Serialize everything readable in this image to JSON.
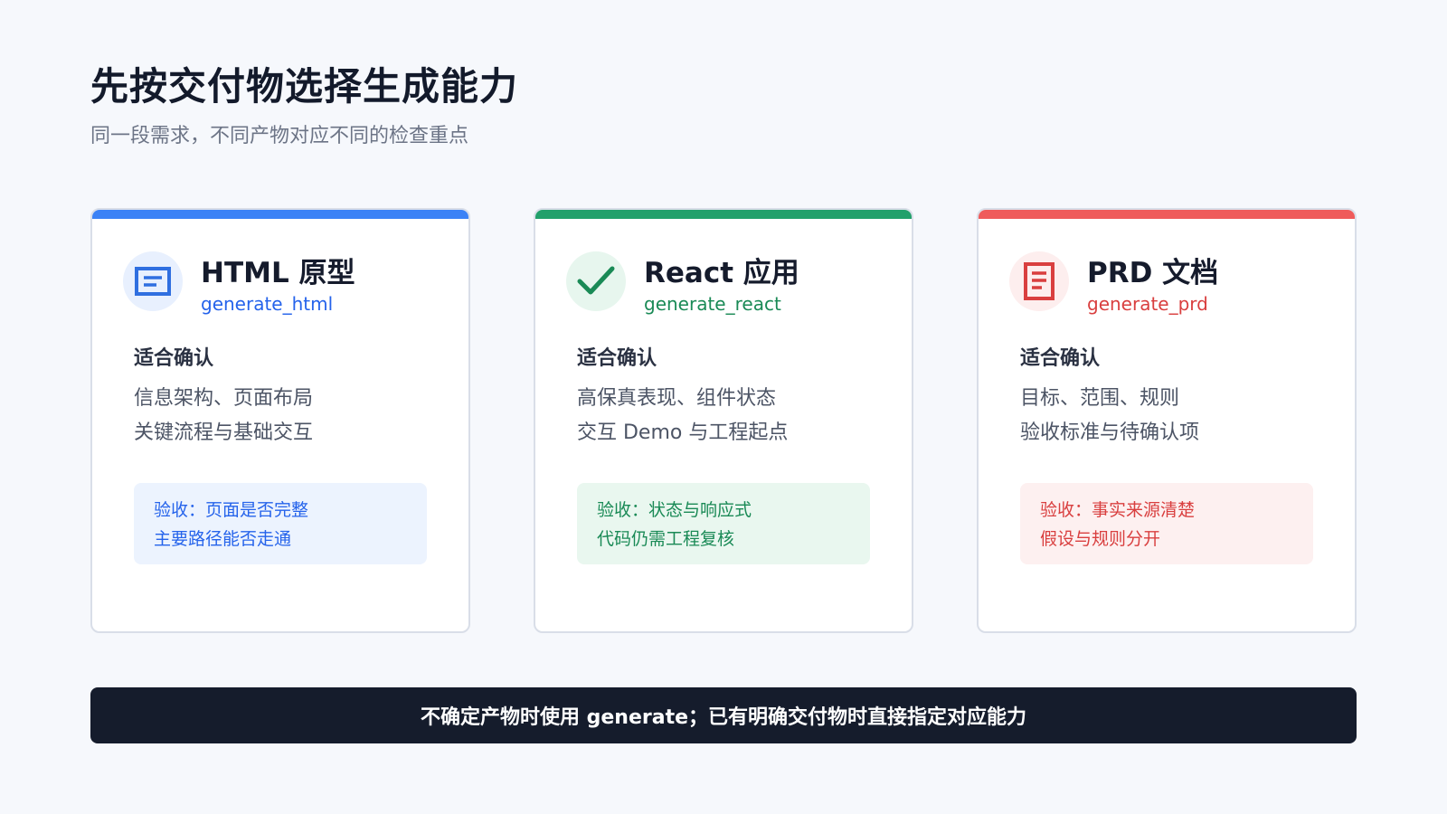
{
  "header": {
    "title": "先按交付物选择生成能力",
    "subtitle": "同一段需求，不同产物对应不同的检查重点"
  },
  "cards": [
    {
      "name": "HTML 原型",
      "fn": "generate_html",
      "icon": "document-window-icon",
      "accent": "#3b82f6",
      "accent_text": "#2563eb",
      "icon_bg": "#e8f0fe",
      "accept_bg": "#ecf3fe",
      "fit_title": "适合确认",
      "fit_lines": [
        "信息架构、页面布局",
        "关键流程与基础交互"
      ],
      "accept_lines": [
        "验收：页面是否完整",
        "主要路径能否走通"
      ]
    },
    {
      "name": "React 应用",
      "fn": "generate_react",
      "icon": "check-icon",
      "accent": "#22a06b",
      "accent_text": "#1a8a56",
      "icon_bg": "#e7f6ee",
      "accept_bg": "#e9f7ef",
      "fit_title": "适合确认",
      "fit_lines": [
        "高保真表现、组件状态",
        "交互 Demo 与工程起点"
      ],
      "accept_lines": [
        "验收：状态与响应式",
        "代码仍需工程复核"
      ]
    },
    {
      "name": "PRD 文档",
      "fn": "generate_prd",
      "icon": "document-lines-icon",
      "accent": "#ef5b5b",
      "accent_text": "#d93f3f",
      "icon_bg": "#fdeeee",
      "accept_bg": "#fdf0f0",
      "fit_title": "适合确认",
      "fit_lines": [
        "目标、范围、规则",
        "验收标准与待确认项"
      ],
      "accept_lines": [
        "验收：事实来源清楚",
        "假设与规则分开"
      ]
    }
  ],
  "footer": {
    "text": "不确定产物时使用 generate；已有明确交付物时直接指定对应能力"
  }
}
